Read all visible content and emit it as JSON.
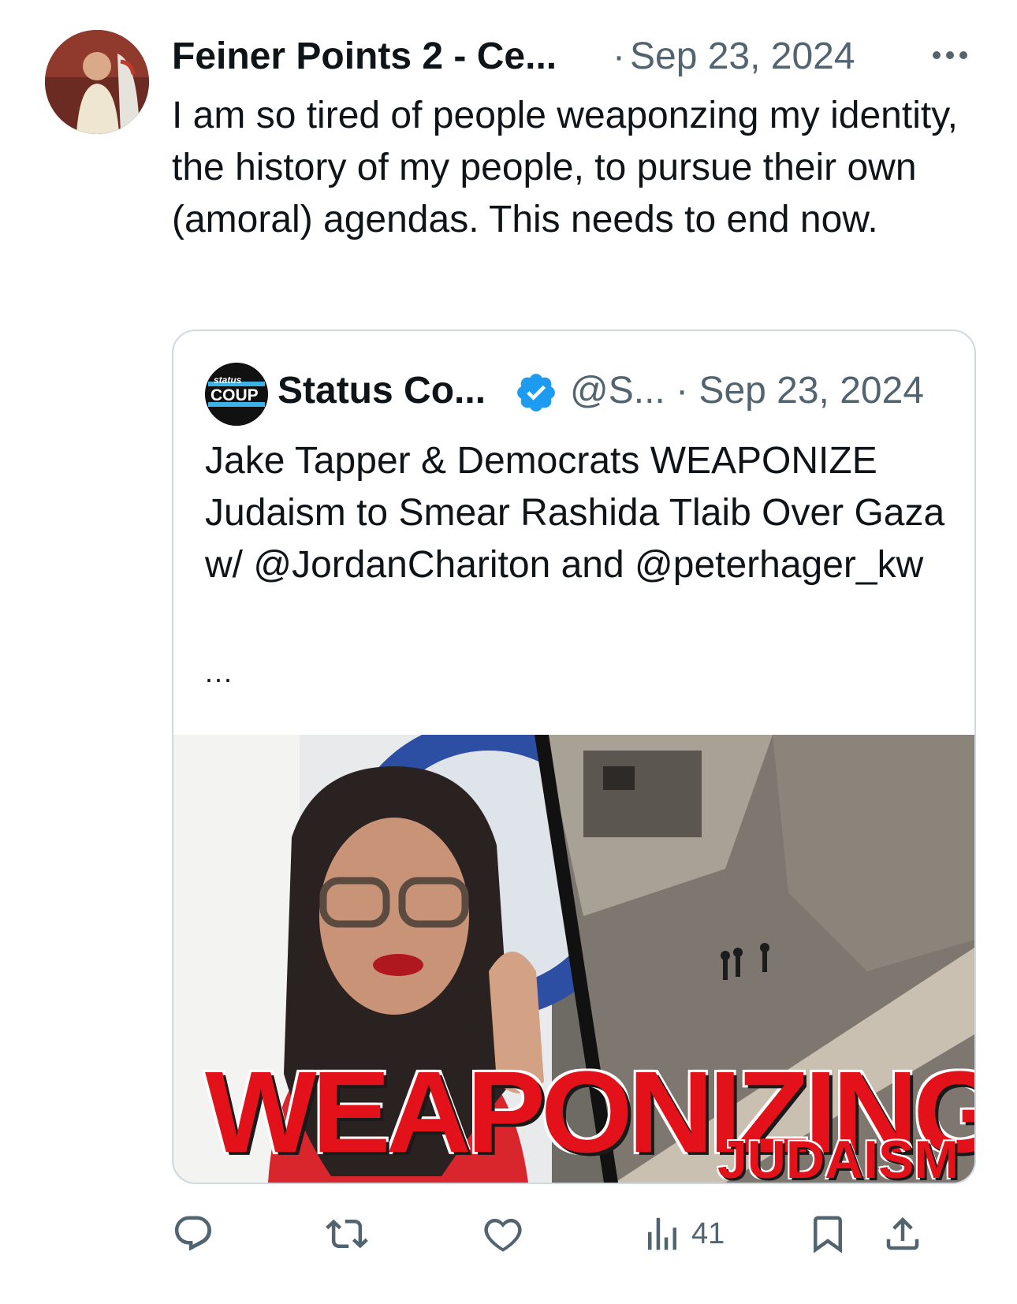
{
  "tweet": {
    "author_name": "Feiner Points 2 - Ce...",
    "date": "Sep 23, 2024",
    "text": "I am so tired of people weaponzing my identity, the history of my people, to pursue their own (amoral) agendas. This needs to end now."
  },
  "quote": {
    "author_name": "Status Co...",
    "handle": "@S...",
    "date": "Sep 23, 2024",
    "avatar_text_top": "status",
    "avatar_text_bottom": "COUP",
    "text": "Jake Tapper & Democrats WEAPONIZE Judaism to Smear Rashida Tlaib Over Gaza w/ @JordanChariton and @peterhager_kw",
    "ellipsis": "...",
    "media_text_main": "WEAPONIZING",
    "media_text_sub": "JUDAISM"
  },
  "actions": {
    "views": "41"
  },
  "icons": {
    "more": "more-dots-icon",
    "verified": "verified-badge-icon",
    "reply": "reply-icon",
    "repost": "repost-icon",
    "like": "like-icon",
    "views": "views-icon",
    "bookmark": "bookmark-icon",
    "share": "share-icon"
  },
  "colors": {
    "text": "#0f1419",
    "secondary": "#536471",
    "border": "#cfd9de",
    "verified": "#1d9bf0",
    "thumbnail_red": "#e3111a"
  }
}
